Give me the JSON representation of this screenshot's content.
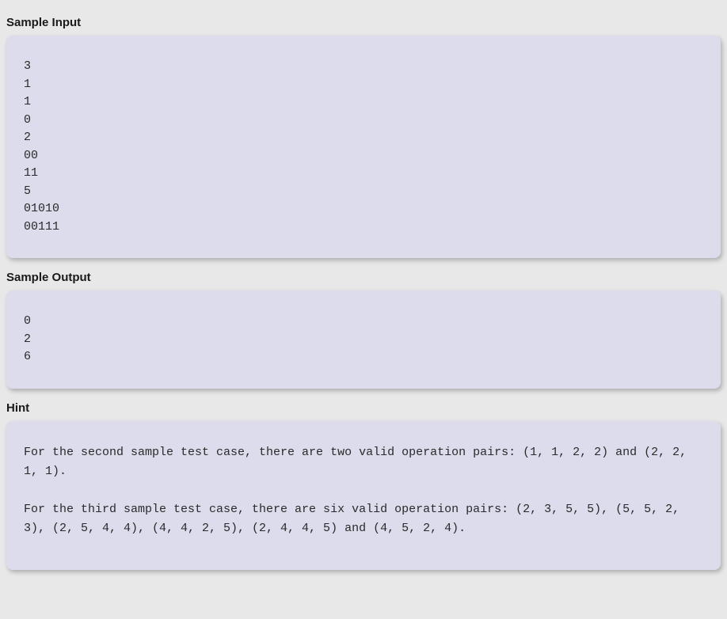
{
  "sections": {
    "sample_input": {
      "title": "Sample Input",
      "content": "3\n1\n1\n0\n2\n00\n11\n5\n01010\n00111"
    },
    "sample_output": {
      "title": "Sample Output",
      "content": "0\n2\n6"
    },
    "hint": {
      "title": "Hint",
      "content": "For the second sample test case, there are two valid operation pairs: (1, 1, 2, 2) and (2, 2, 1, 1).\n\nFor the third sample test case, there are six valid operation pairs: (2, 3, 5, 5), (5, 5, 2, 3), (2, 5, 4, 4), (4, 4, 2, 5), (2, 4, 4, 5) and (4, 5, 2, 4)."
    }
  }
}
